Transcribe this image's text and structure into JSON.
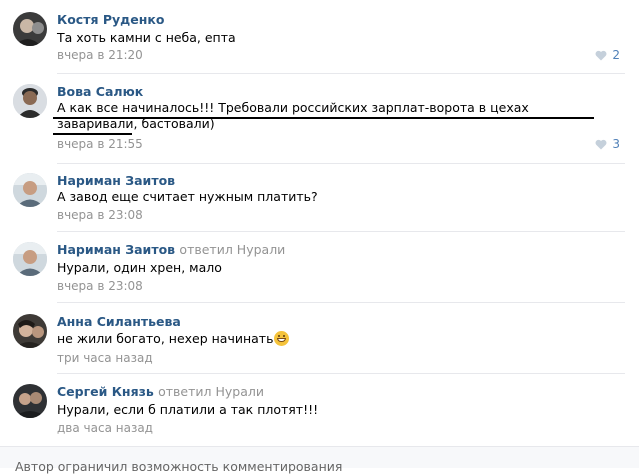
{
  "comments": [
    {
      "author": "Костя Руденко",
      "reply_word": "",
      "reply_to": "",
      "text": "Та хоть камни с неба, епта",
      "time": "вчера в 21:20",
      "likes": "2"
    },
    {
      "author": "Вова Салюк",
      "reply_word": "",
      "reply_to": "",
      "text": "А как все начиналось!!! Требовали российских зарплат-ворота в цехах заваривали, бастовали)",
      "time": "вчера в 21:55",
      "likes": "3"
    },
    {
      "author": "Нариман Заитов",
      "reply_word": "",
      "reply_to": "",
      "text": "А завод еще считает нужным платить?",
      "time": "вчера в 23:08",
      "likes": ""
    },
    {
      "author": "Нариман Заитов",
      "reply_word": "ответил",
      "reply_to": "Нурали",
      "text": "Нурали, один хрен, мало",
      "time": "вчера в 23:08",
      "likes": ""
    },
    {
      "author": "Анна Силантьева",
      "reply_word": "",
      "reply_to": "",
      "text": "не жили богато, нехер начинать",
      "time": "три часа назад",
      "likes": ""
    },
    {
      "author": "Сергей Князь",
      "reply_word": "ответил",
      "reply_to": "Нурали",
      "text": "Нурали, если б платили а так плотят!!!",
      "time": "два часа назад",
      "likes": ""
    }
  ],
  "footer": {
    "text": "Автор ограничил возможность комментирования"
  },
  "colors": {
    "author": "#2a5885",
    "meta": "#939393",
    "like": "#5181b8"
  }
}
